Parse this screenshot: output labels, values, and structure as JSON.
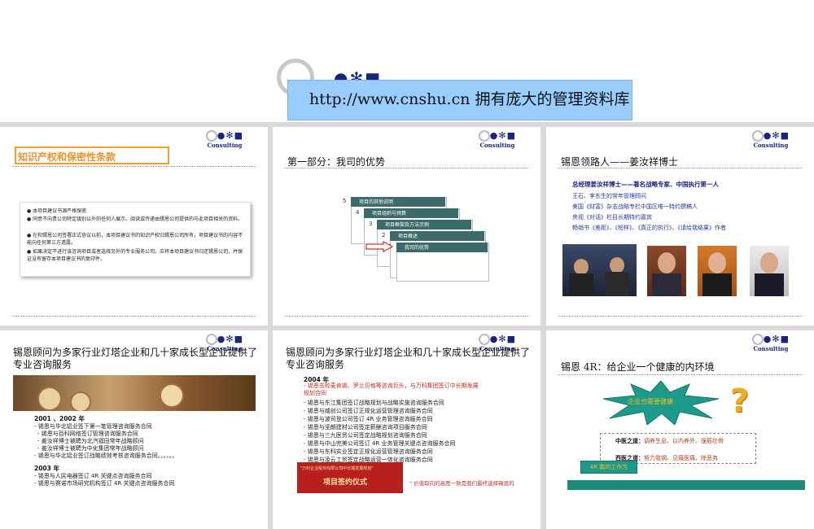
{
  "banner": {
    "text": "http://www.cnshu.cn   拥有庞大的管理资料库"
  },
  "logo": {
    "mark": "●✻■",
    "consulting": "Consulting"
  },
  "slide1": {
    "title": "知识产权和保密性条款",
    "bullets": [
      "本项目建议书源严格保密",
      "同意不向贵公司特定级别以外的任何人展示、阅读或传递由锡恩公司提供的与此项目相关的资料。",
      "在和锡恩公司签署正式协议以前，本项目建议书的知识产权归锡恩公司所有，项目建议书的内容不能向任何第三方透露。",
      "如果决定不进行该咨询项目或者选择另外的专业服务公司，应将本项目建议书归还锡恩公司，并保证没有留存本项目建议书的复印件。"
    ]
  },
  "slide2": {
    "title": "第一部分：我司的优势",
    "items": [
      {
        "num": "5",
        "label": "项目的其他说明"
      },
      {
        "num": "4",
        "label": "项目组织与预算"
      },
      {
        "num": "3",
        "label": "项目框架及方法示例"
      },
      {
        "num": "2",
        "label": "项目概述"
      },
      {
        "num": "1",
        "label": "我司的优势"
      }
    ]
  },
  "slide3": {
    "title": "锡恩领路人——姜汝祥博士",
    "headline": "总经理姜汝祥博士——著名战略专家、中国执行第一人",
    "lines": [
      "王石、李东生的常年管理顾问",
      "美国《财富》杂志战略专栏中国区唯一特约撰稿人",
      "央视《对话》栏目长期特约嘉宾",
      "畅销书《差距》、《榜样》、《真正的执行》、《请给我结果》作者"
    ]
  },
  "slide4": {
    "title": "锡恩顾问为多家行业灯塔企业和几十家成长型企业提供了专业咨询服务",
    "year1": "2001 、2002 年",
    "items1": [
      "锡恩与华北铝业签下第一笔管理咨询服务合同",
      "锡恩与百科网络签订管理咨询服务合同",
      "姜汝祥博士被聘为北汽福田常年战略顾问",
      "姜汝祥博士被聘为中化集团常年战略顾问",
      "锡恩与华北铝业签订战略绩效考核咨询服务合同。。。。。。"
    ],
    "year2": "2003 年",
    "items2": [
      "锡恩与人民电器签订 4R 关键点咨询服务合同",
      "锡恩与赛诺市场研究机构签订 4R 关键点咨询服务合同"
    ]
  },
  "slide5": {
    "title": "锡恩顾问为多家行业灯塔企业和几十家成长型企业提供了专业咨询服务",
    "year": "2004 年",
    "highlight": "锡恩击败麦肯锡、罗兰贝格等咨询巨头，与万科集团签订中长期发展规划合同",
    "items": [
      "锡恩与东江集团签订战略规划与战略实施咨询服务合同",
      "锡恩与威创公司签订正规化运营管理咨询服务合同",
      "锡恩与波司登公司签订 4R 业务管理咨询服务合同",
      "锡恩与坚朗建材公司签定薪酬咨询项目服务合同",
      "锡恩与三九医贸公司签定战略规划咨询服务合同",
      "锡恩与中山完美公司签订 4R 业务管理关键点咨询服务合同",
      "锡恩与东科实业签定正规化运营管理咨询服务合同",
      "锡恩与凌云工贸签定战略运营一体化咨询服务合同"
    ],
    "photo_banner": "\"万科企业股份有限公司中长期发展规划\"",
    "photo_title": "项目签约仪式",
    "quote": "价值取向的高度一致是我们最终选择锡恩的"
  },
  "slide6": {
    "title": "锡恩 4R：给企业一个健康的内环境",
    "burst": "企业也需要健康",
    "question": "?",
    "tcm_label": "中医之道：",
    "tcm_text": "调养生息、以内养外、强筋壮骨",
    "west_label": "西医之道：",
    "west_text": "努力我钢、见痛医痛、除恶务",
    "tag": "4R 我的工作方"
  }
}
